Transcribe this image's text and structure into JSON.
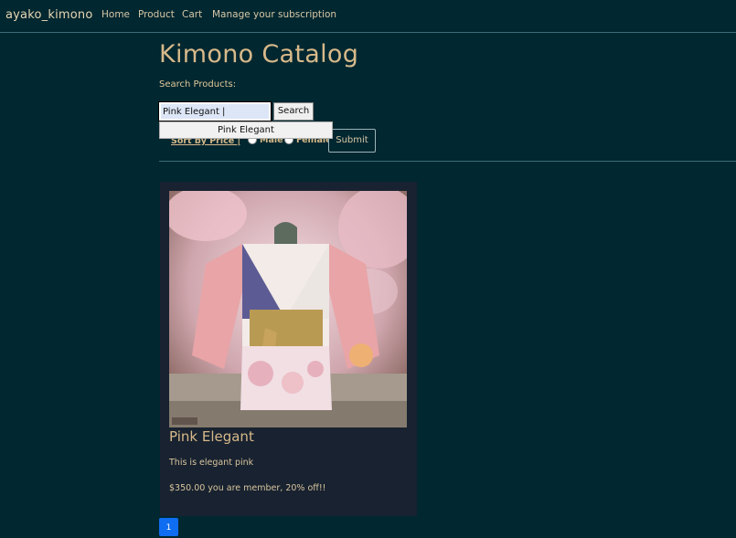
{
  "navbar": {
    "brand": "ayako_kimono",
    "links": [
      "Home",
      "Product",
      "Cart",
      "Manage your subscription"
    ]
  },
  "page": {
    "title": "Kimono Catalog",
    "search_label": "Search Products:",
    "search_value": "Pink Elegant |",
    "search_button": "Search",
    "autocomplete_option": "Pink Elegant",
    "sort_link": "Sort by Price |",
    "radio_male": "Male",
    "radio_female": "Female",
    "submit_button": "Submit"
  },
  "products": [
    {
      "name": "Pink Elegant",
      "description": "This is elegant pink",
      "price": "$350.00 you are member, 20% off!!",
      "image_icon": "pink-kimono-photo"
    }
  ],
  "pagination": {
    "current": "1"
  },
  "colors": {
    "background": "#012730",
    "accent": "#d8b98a",
    "card": "#182230",
    "page_button": "#0f6df2"
  }
}
